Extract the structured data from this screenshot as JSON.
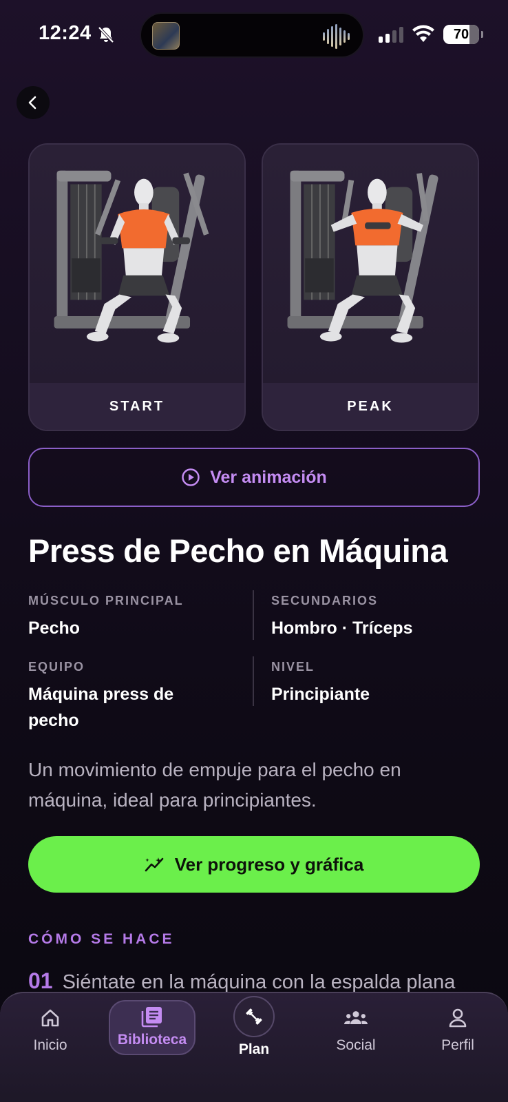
{
  "status_bar": {
    "time": "12:24",
    "battery": "70"
  },
  "header": {
    "back_icon": "chevron-left-icon"
  },
  "cards": [
    {
      "label": "START"
    },
    {
      "label": "PEAK"
    }
  ],
  "animation_button": {
    "label": "Ver animación",
    "icon": "play-circle-icon"
  },
  "exercise": {
    "title": "Press de Pecho en Máquina",
    "primary_muscle_label": "MÚSCULO PRINCIPAL",
    "primary_muscle": "Pecho",
    "secondary_label": "SECUNDARIOS",
    "secondary": "Hombro · Tríceps",
    "equipment_label": "EQUIPO",
    "equipment": "Máquina press de pecho",
    "level_label": "NIVEL",
    "level": "Principiante",
    "description": "Un movimiento de empuje para el pecho en máquina, ideal para principiantes."
  },
  "progress_button": {
    "label": "Ver progreso y gráfica",
    "icon": "chart-sparkle-icon"
  },
  "how_to": {
    "title": "CÓMO SE HACE",
    "steps": [
      {
        "num": "01",
        "text": "Siéntate en la máquina con la espalda plana"
      }
    ]
  },
  "bottom_nav": {
    "items": [
      {
        "label": "Inicio",
        "icon": "home-icon"
      },
      {
        "label": "Biblioteca",
        "icon": "library-icon",
        "active": true
      },
      {
        "label": "Plan",
        "icon": "dumbbell-icon"
      },
      {
        "label": "Social",
        "icon": "people-icon"
      },
      {
        "label": "Perfil",
        "icon": "user-icon"
      }
    ]
  },
  "colors": {
    "accent_purple": "#c48cf2",
    "accent_green": "#6bef4b",
    "muscle_highlight": "#f26b2f"
  }
}
